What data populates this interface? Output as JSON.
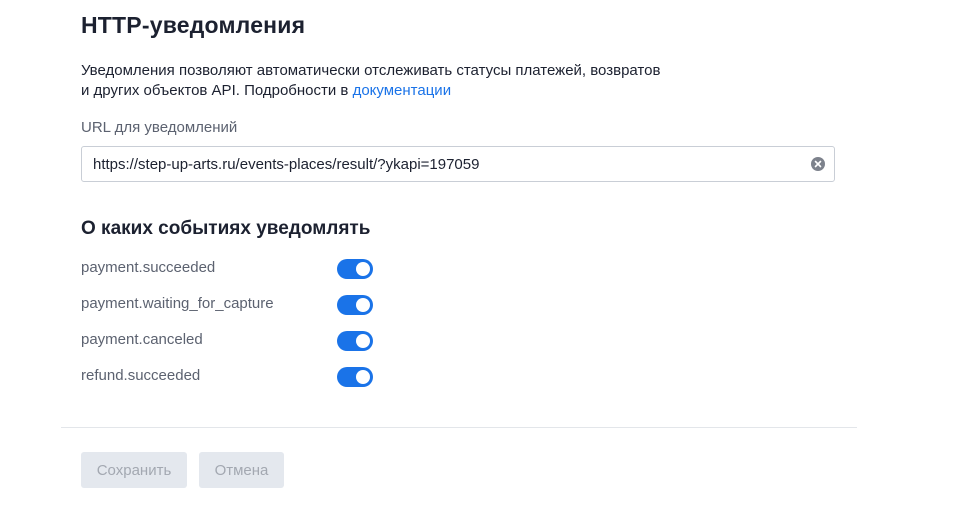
{
  "header": {
    "title": "HTTP-уведомления"
  },
  "description": {
    "line1": "Уведомления позволяют автоматически отслеживать статусы платежей, возвратов",
    "line2_prefix": "и других объектов API. Подробности в ",
    "link_text": "документации"
  },
  "url_section": {
    "label": "URL для уведомлений",
    "value": "https://step-up-arts.ru/events-places/result/?ykapi=197059",
    "clear_icon": "clear-circle-icon"
  },
  "events": {
    "title": "О каких событиях уведомлять",
    "items": [
      {
        "label": "payment.succeeded",
        "enabled": true
      },
      {
        "label": "payment.waiting_for_capture",
        "enabled": true
      },
      {
        "label": "payment.canceled",
        "enabled": true
      },
      {
        "label": "refund.succeeded",
        "enabled": true
      }
    ]
  },
  "actions": {
    "save_label": "Сохранить",
    "cancel_label": "Отмена",
    "save_disabled": true,
    "cancel_disabled": true
  },
  "colors": {
    "accent": "#1a73e8",
    "text_primary": "#1c2130",
    "text_secondary": "#5c6270",
    "button_disabled_bg": "#e4e8ee",
    "button_disabled_text": "#a3a8b1"
  }
}
